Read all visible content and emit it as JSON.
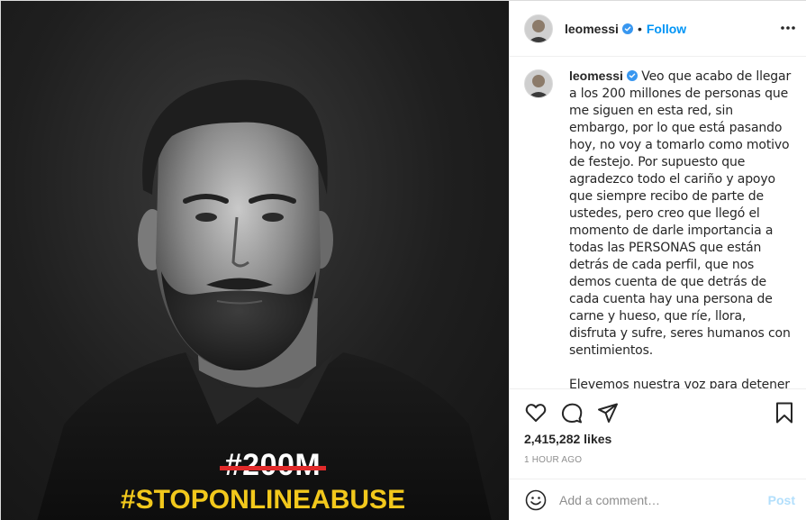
{
  "photo": {
    "strike_text": "#200M",
    "hashtag": "#STOPONLINEABUSE",
    "colors": {
      "strike_line": "#e12a2a",
      "hashtag": "#f2c81c"
    }
  },
  "header": {
    "username": "leomessi",
    "separator": "•",
    "follow_label": "Follow",
    "more_icon": "more-horizontal-icon"
  },
  "caption": {
    "username": "leomessi",
    "paragraph_1": "Veo que acabo de llegar a los 200 millones de personas que me siguen en esta red, sin embargo, por lo que está pasando hoy, no voy a tomarlo como motivo de festejo. Por supuesto que agradezco todo el cariño y apoyo que siempre recibo de parte de ustedes, pero creo que llegó el momento de darle importancia a todas las PERSONAS que están detrás de cada perfil, que nos demos cuenta de que detrás de cada cuenta hay una persona de carne y hueso, que ríe, llora, disfruta y sufre, seres humanos con sentimientos.",
    "paragraph_2": "Elevemos nuestra voz para detener el abuso en las redes sociales. Da igual si somos anónimos, famosos, deportistas, árbitros o seguidores de"
  },
  "actions": {
    "icons": [
      "heart-icon",
      "comment-icon",
      "share-icon",
      "bookmark-icon"
    ],
    "likes": "2,415,282 likes",
    "timestamp": "1 HOUR AGO"
  },
  "comment": {
    "placeholder": "Add a comment…",
    "post_label": "Post"
  },
  "colors": {
    "accent": "#0095f6",
    "verified": "#3897f0",
    "post_disabled": "#b2dffc",
    "muted": "#8e8e8e"
  }
}
